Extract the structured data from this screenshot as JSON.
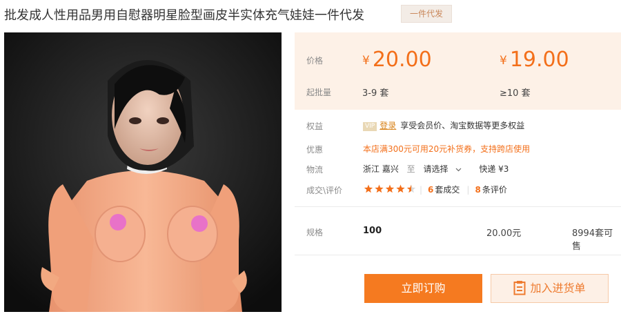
{
  "product": {
    "title": "批发成人性用品男用自慰器明星脸型画皮半实体充气娃娃一件代发",
    "badge": "一件代发"
  },
  "pricing": {
    "price_label": "价格",
    "qty_label": "起批量",
    "tiers": [
      {
        "currency": "¥",
        "price": "20.00",
        "qty": "3-9 套"
      },
      {
        "currency": "¥",
        "price": "19.00",
        "qty": "≥10 套"
      }
    ]
  },
  "rights": {
    "label": "权益",
    "vip": "VIP",
    "login": "登录",
    "text": "享受会员价、淘宝数据等更多权益"
  },
  "discount": {
    "label": "优惠",
    "text": "本店满300元可用20元补货券，支持跨店使用"
  },
  "logistics": {
    "label": "物流",
    "origin": "浙江 嘉兴",
    "to": "至",
    "select": "请选择",
    "shipping": "快递 ¥3"
  },
  "deals": {
    "label": "成交\\评价",
    "rating": 4.5,
    "deal_count": "6",
    "deal_suffix": "套成交",
    "review_count": "8",
    "review_suffix": "条评价"
  },
  "spec": {
    "label": "规格",
    "value": "100",
    "price": "20.00元",
    "stock": "8994套可售"
  },
  "actions": {
    "buy": "立即订购",
    "add": "加入进货单"
  },
  "colors": {
    "accent": "#f57a20",
    "panel_bg": "#fdf1e7"
  }
}
